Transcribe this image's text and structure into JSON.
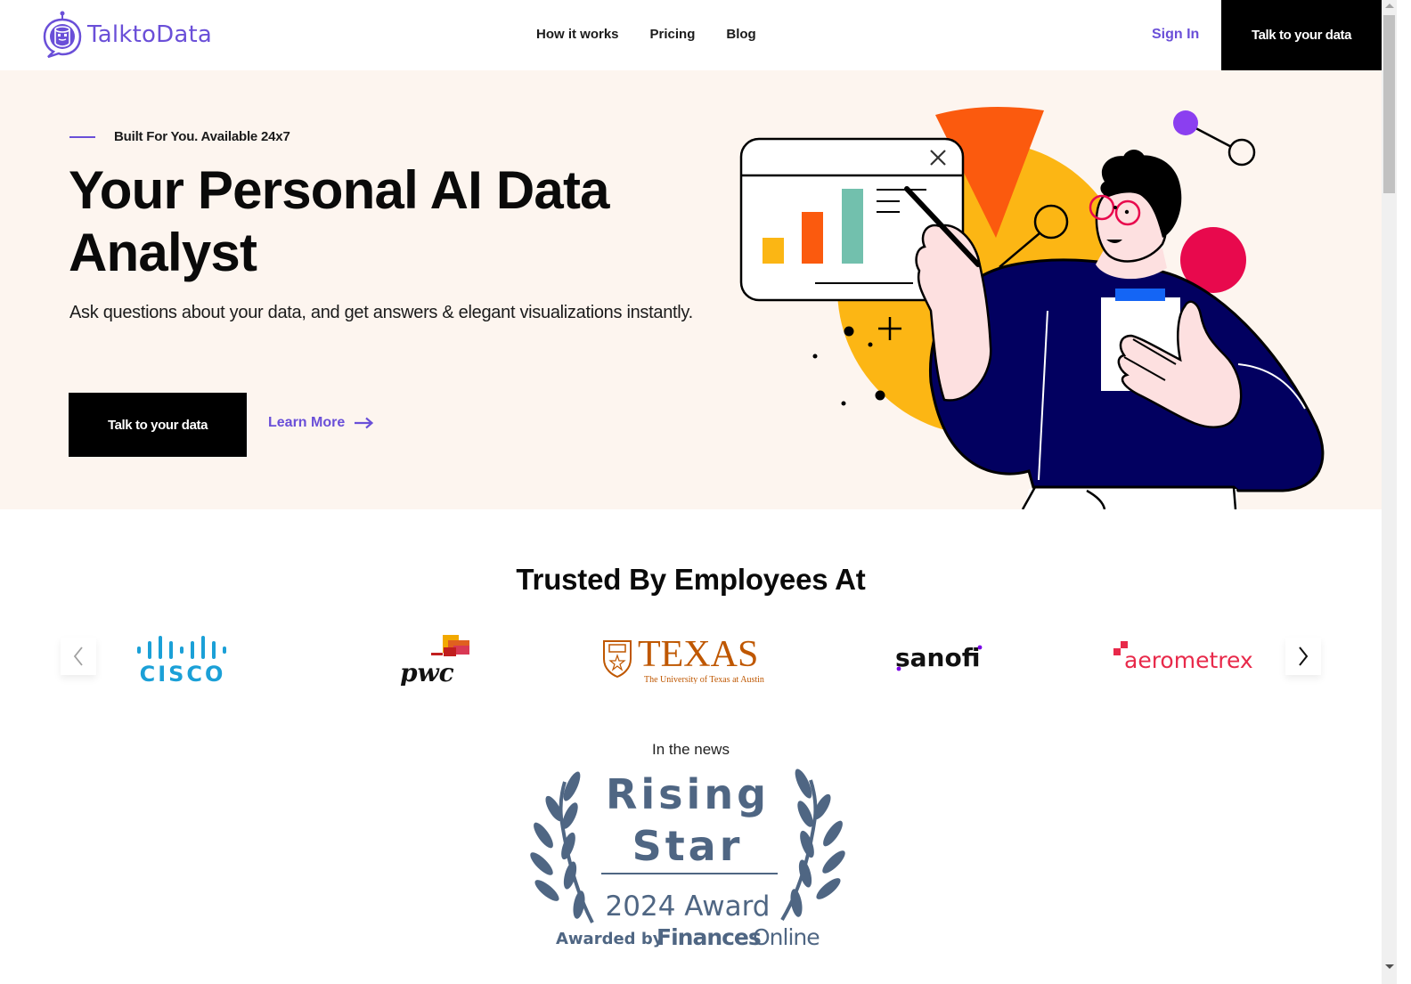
{
  "brand": {
    "name": "TalktoData",
    "color": "#6a4fd8"
  },
  "nav": {
    "items": [
      {
        "label": "How it works"
      },
      {
        "label": "Pricing"
      },
      {
        "label": "Blog"
      }
    ],
    "sign_in": "Sign In",
    "cta": "Talk to your data"
  },
  "hero": {
    "tagline": "Built For You. Available 24x7",
    "title": "Your Personal AI Data Analyst",
    "subtitle": "Ask questions about your data, and get answers & elegant visualizations instantly.",
    "cta": "Talk to your data",
    "learn_more": "Learn More",
    "background": "#fdf5ef",
    "illustration": {
      "description": "person-presenting-bar-chart",
      "chart_bar_colors": [
        "#fbb614",
        "#fb5a0e",
        "#72c0ad"
      ]
    }
  },
  "trusted": {
    "title": "Trusted By Employees At",
    "logos": [
      {
        "name": "cisco",
        "text": "CISCO",
        "color": "#1ba0d7"
      },
      {
        "name": "pwc",
        "text": "pwc",
        "color": "#111111"
      },
      {
        "name": "texas",
        "text": "TEXAS",
        "subtext": "The University of Texas at Austin",
        "color": "#bf5700"
      },
      {
        "name": "sanofi",
        "text": "sanofi",
        "color": "#111111",
        "accent": "#7a00e6"
      },
      {
        "name": "aerometrex",
        "text": "aerometrex",
        "color": "#e8294a"
      }
    ]
  },
  "news": {
    "label": "In the news",
    "award": {
      "line1": "Rising",
      "line2": "Star",
      "year_line": "2024 Award",
      "awarded_by": "Awarded by",
      "org_bold": "Finances",
      "org_light": "Online",
      "color": "#4f6683"
    }
  }
}
